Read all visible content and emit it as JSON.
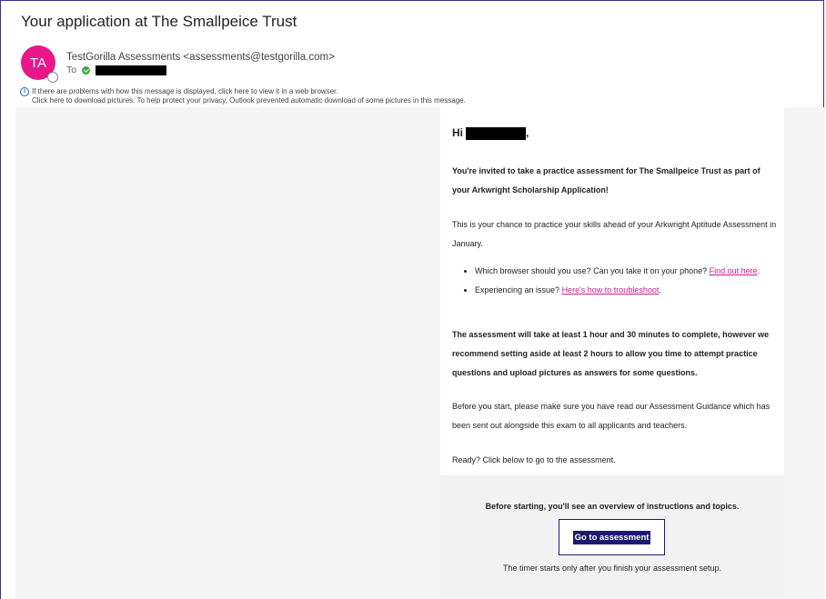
{
  "email": {
    "subject": "Your application at The Smallpeice Trust",
    "avatar_initials": "TA",
    "sender": "TestGorilla Assessments <assessments@testgorilla.com>",
    "to_label": "To",
    "info_line1": "If there are problems with how this message is displayed, click here to view it in a web browser.",
    "info_line2": "Click here to download pictures. To help protect your privacy, Outlook prevented automatic download of some pictures in this message."
  },
  "body": {
    "greeting": "Hi",
    "greeting_suffix": ",",
    "invite": "You're invited to take a practice assessment for The Smallpeice Trust as part of your Arkwright Scholarship Application!",
    "chance": "This is your chance to practice your skills ahead of your Arkwright Aptitude Assessment in January.",
    "bullet1_text": "Which browser should you use? Can you take it on your phone? ",
    "bullet1_link": "Find out here",
    "bullet1_end": ".",
    "bullet2_text": "Experiencing an issue? ",
    "bullet2_link": "Here's how to troubleshoot",
    "bullet2_end": ".",
    "duration": "The assessment will take at least 1 hour and 30 minutes to complete, however we recommend setting aside at least 2 hours to allow you time to attempt practice questions and upload pictures as answers for some questions.",
    "guidance": "Before you start, please make sure you have read our Assessment Guidance which has been sent out alongside this exam to all applicants and teachers.",
    "ready": "Ready? Click below to go to the assessment."
  },
  "cta": {
    "heading": "Before starting, you'll see an overview of instructions and topics.",
    "button_label": "Go to assessment",
    "footer": "The timer starts only after you finish your assessment setup."
  },
  "colors": {
    "avatar": "#e8178a",
    "link": "#d01a8f",
    "button": "#1b1a70",
    "frame_border": "#3a2f8f"
  }
}
